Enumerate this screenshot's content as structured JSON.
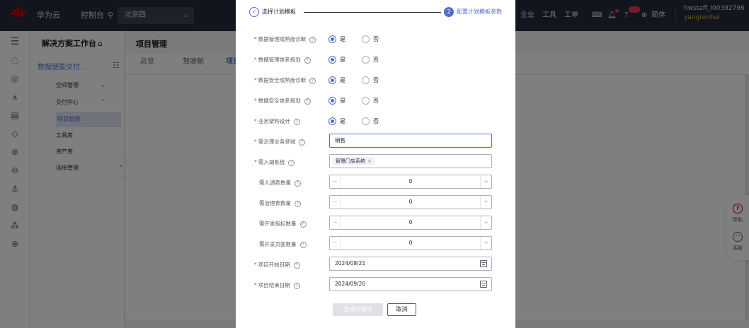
{
  "topbar": {
    "brand_text": "HUAWEI",
    "cloud_name": "华为云",
    "console": "控制台",
    "region": "北京四",
    "right_items": [
      "企业",
      "工具",
      "工单"
    ],
    "lang": "简体",
    "user_id": "hwstaff_l00392796",
    "user_name": "yangrenhui"
  },
  "nav": {
    "title": "解决方案工作台",
    "workspace": "数据使能交付...",
    "items": [
      {
        "label": "空间管理",
        "chevron": "⌄"
      },
      {
        "label": "交付中心",
        "chevron": "⌃"
      },
      {
        "label": "项目管理"
      },
      {
        "label": "工具库"
      },
      {
        "label": "资产库"
      },
      {
        "label": "连接管理"
      }
    ]
  },
  "main": {
    "title": "项目管理",
    "tabs": [
      "总览",
      "驾驶舱",
      "项目"
    ]
  },
  "right_tools": {
    "help": "帮助",
    "service": "客服"
  },
  "dialog": {
    "steps": [
      {
        "label": "选择计划模板",
        "status": "done"
      },
      {
        "label": "配置计划模板参数",
        "status": "current",
        "index": "2"
      }
    ],
    "radio_rows": [
      {
        "label": "数据管理成熟度诊断",
        "yes": "是",
        "no": "否",
        "value": "是"
      },
      {
        "label": "数据管理体系规划",
        "yes": "是",
        "no": "否",
        "value": "是"
      },
      {
        "label": "数据安全成熟度诊断",
        "yes": "是",
        "no": "否",
        "value": "是"
      },
      {
        "label": "数据安全体系规划",
        "yes": "是",
        "no": "否",
        "value": "是"
      },
      {
        "label": "业务架构设计",
        "yes": "是",
        "no": "否",
        "value": "是"
      }
    ],
    "domain_field": {
      "label": "需治理业务领域",
      "value": "销售"
    },
    "system_field": {
      "label": "需入湖系统",
      "tag": "智慧门店系统"
    },
    "steppers": [
      {
        "label": "需入湖表数量",
        "value": "0"
      },
      {
        "label": "需治理表数量",
        "value": "0"
      },
      {
        "label": "需开发指标数量",
        "value": "0"
      },
      {
        "label": "需开发页面数量",
        "value": "0"
      }
    ],
    "start_date": {
      "label": "项目开始日期",
      "value": "2024/08/21"
    },
    "end_date": {
      "label": "项目结束日期",
      "value": "2024/09/20"
    },
    "generate_btn": "生成计划项",
    "cancel_btn": "取消"
  },
  "colors": {
    "accent": "#526ecc",
    "required": "#e6385c",
    "topbar": "#252b3a",
    "brand": "#c7000b"
  }
}
